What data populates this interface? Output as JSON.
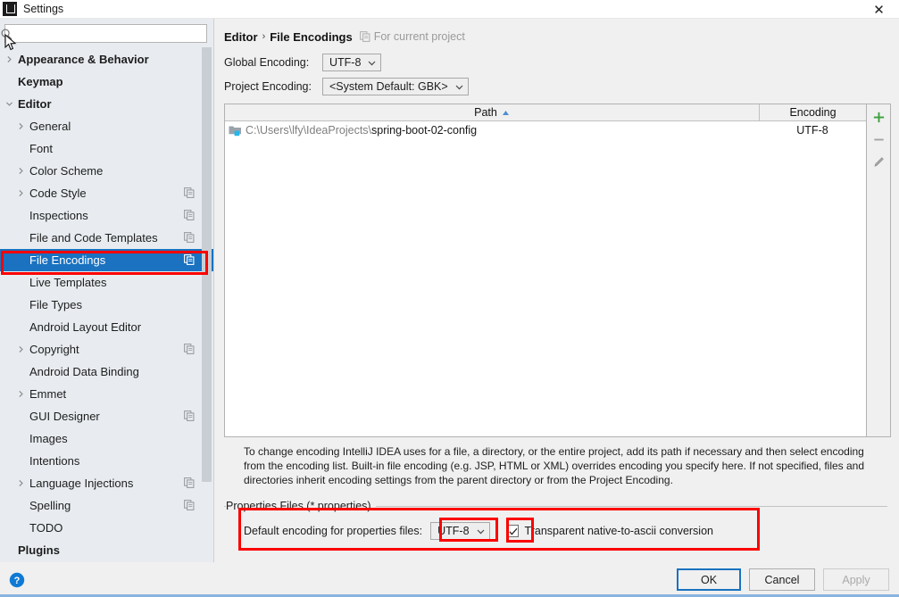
{
  "window": {
    "title": "Settings",
    "app_icon": "idea-icon",
    "close_label": "✕"
  },
  "sidebar": {
    "search": {
      "placeholder": "",
      "value": "",
      "icon": "search-icon"
    },
    "items": [
      {
        "label": "Appearance & Behavior",
        "level": 0,
        "bold": true,
        "arrow": "chevron-right",
        "copy": false
      },
      {
        "label": "Keymap",
        "level": 0,
        "bold": true,
        "arrow": "",
        "copy": false
      },
      {
        "label": "Editor",
        "level": 0,
        "bold": true,
        "arrow": "chevron-down",
        "copy": false
      },
      {
        "label": "General",
        "level": 1,
        "bold": false,
        "arrow": "chevron-right",
        "copy": false
      },
      {
        "label": "Font",
        "level": 1,
        "bold": false,
        "arrow": "",
        "copy": false
      },
      {
        "label": "Color Scheme",
        "level": 1,
        "bold": false,
        "arrow": "chevron-right",
        "copy": false
      },
      {
        "label": "Code Style",
        "level": 1,
        "bold": false,
        "arrow": "chevron-right",
        "copy": true
      },
      {
        "label": "Inspections",
        "level": 1,
        "bold": false,
        "arrow": "",
        "copy": true
      },
      {
        "label": "File and Code Templates",
        "level": 1,
        "bold": false,
        "arrow": "",
        "copy": true
      },
      {
        "label": "File Encodings",
        "level": 1,
        "bold": false,
        "arrow": "",
        "copy": true,
        "selected": true
      },
      {
        "label": "Live Templates",
        "level": 1,
        "bold": false,
        "arrow": "",
        "copy": false
      },
      {
        "label": "File Types",
        "level": 1,
        "bold": false,
        "arrow": "",
        "copy": false
      },
      {
        "label": "Android Layout Editor",
        "level": 1,
        "bold": false,
        "arrow": "",
        "copy": false
      },
      {
        "label": "Copyright",
        "level": 1,
        "bold": false,
        "arrow": "chevron-right",
        "copy": true
      },
      {
        "label": "Android Data Binding",
        "level": 1,
        "bold": false,
        "arrow": "",
        "copy": false
      },
      {
        "label": "Emmet",
        "level": 1,
        "bold": false,
        "arrow": "chevron-right",
        "copy": false
      },
      {
        "label": "GUI Designer",
        "level": 1,
        "bold": false,
        "arrow": "",
        "copy": true
      },
      {
        "label": "Images",
        "level": 1,
        "bold": false,
        "arrow": "",
        "copy": false
      },
      {
        "label": "Intentions",
        "level": 1,
        "bold": false,
        "arrow": "",
        "copy": false
      },
      {
        "label": "Language Injections",
        "level": 1,
        "bold": false,
        "arrow": "chevron-right",
        "copy": true
      },
      {
        "label": "Spelling",
        "level": 1,
        "bold": false,
        "arrow": "",
        "copy": true
      },
      {
        "label": "TODO",
        "level": 1,
        "bold": false,
        "arrow": "",
        "copy": false
      },
      {
        "label": "Plugins",
        "level": 0,
        "bold": true,
        "arrow": "",
        "copy": false
      }
    ]
  },
  "main": {
    "breadcrumb": {
      "parent": "Editor",
      "separator": "›",
      "current": "File Encodings",
      "scope_icon": "copy-icon",
      "scope": "For current project"
    },
    "global_encoding": {
      "label": "Global Encoding:",
      "value": "UTF-8"
    },
    "project_encoding": {
      "label": "Project Encoding:",
      "value": "<System Default: GBK>"
    },
    "table": {
      "columns": [
        "Path",
        "Encoding"
      ],
      "sort_column": "Path",
      "sort_direction": "ascending",
      "rows": [
        {
          "icon": "folder-icon",
          "path_prefix": "C:\\Users\\lfy\\IdeaProjects\\",
          "path_name": "spring-boot-02-config",
          "encoding": "UTF-8"
        }
      ],
      "tools": [
        {
          "name": "add-button",
          "glyph": "+",
          "color": "#3aa03a"
        },
        {
          "name": "remove-button",
          "glyph": "−",
          "color": "#9a9a9a"
        },
        {
          "name": "edit-button",
          "glyph": "pencil",
          "color": "#9a9a9a"
        }
      ]
    },
    "description": "To change encoding IntelliJ IDEA uses for a file, a directory, or the entire project, add its path if necessary and then select encoding from the encoding list. Built-in file encoding (e.g. JSP, HTML or XML) overrides encoding you specify here. If not specified, files and directories inherit encoding settings from the parent directory or from the Project Encoding.",
    "properties_group": {
      "title": "Properties Files (*.properties)",
      "default_encoding_label": "Default encoding for properties files:",
      "default_encoding_value": "UTF-8",
      "transparent_checkbox_label": "Transparent native-to-ascii conversion",
      "transparent_checkbox_checked": true
    }
  },
  "footer": {
    "help_icon": "help-icon",
    "ok": "OK",
    "cancel": "Cancel",
    "apply": "Apply",
    "apply_disabled": true
  },
  "colors": {
    "selection_blue": "#1a72c0",
    "annotation_red": "#fb0000",
    "add_green": "#3aa03a",
    "help_blue": "#0f7ad4"
  }
}
